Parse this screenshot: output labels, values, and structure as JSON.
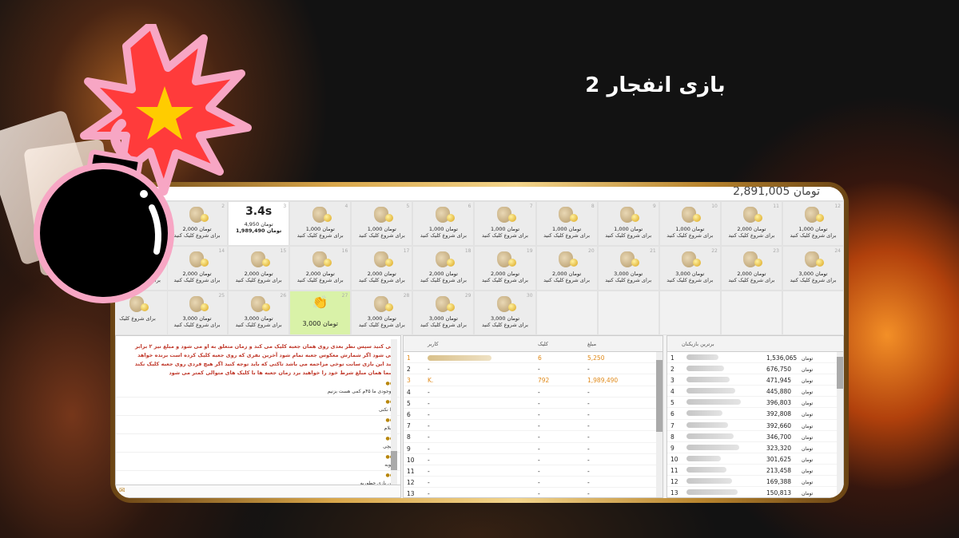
{
  "page": {
    "title": "بازی انفجار 2"
  },
  "header": {
    "balance": "2,891,005",
    "balance_unit": "تومان"
  },
  "tiles": [
    {
      "num": "12",
      "amount": "1,000",
      "unit": "تومان",
      "caption": "برای شروع کلیک کنید",
      "state": "normal"
    },
    {
      "num": "11",
      "amount": "2,000",
      "unit": "تومان",
      "caption": "برای شروع کلیک کنید",
      "state": "normal"
    },
    {
      "num": "10",
      "amount": "1,000",
      "unit": "تومان",
      "caption": "برای شروع کلیک کنید",
      "state": "normal"
    },
    {
      "num": "9",
      "amount": "1,000",
      "unit": "تومان",
      "caption": "برای شروع کلیک کنید",
      "state": "normal"
    },
    {
      "num": "8",
      "amount": "1,000",
      "unit": "تومان",
      "caption": "برای شروع کلیک کنید",
      "state": "normal"
    },
    {
      "num": "7",
      "amount": "1,000",
      "unit": "تومان",
      "caption": "برای شروع کلیک کنید",
      "state": "normal"
    },
    {
      "num": "6",
      "amount": "1,000",
      "unit": "تومان",
      "caption": "برای شروع کلیک کنید",
      "state": "normal"
    },
    {
      "num": "5",
      "amount": "1,000",
      "unit": "تومان",
      "caption": "برای شروع کلیک کنید",
      "state": "normal"
    },
    {
      "num": "4",
      "amount": "1,000",
      "unit": "تومان",
      "caption": "برای شروع کلیک کنید",
      "state": "normal"
    },
    {
      "num": "3",
      "timer": "3.4s",
      "amount": "4,950",
      "unit": "تومان",
      "total": "1,989,490",
      "state": "active"
    },
    {
      "num": "2",
      "amount": "2,000",
      "unit": "تومان",
      "caption": "برای شروع کلیک کنید",
      "state": "normal"
    },
    {
      "num": "24",
      "amount": "3,000",
      "unit": "تومان",
      "caption": "برای شروع کلیک کنید",
      "state": "normal"
    },
    {
      "num": "23",
      "amount": "2,000",
      "unit": "تومان",
      "caption": "برای شروع کلیک کنید",
      "state": "normal"
    },
    {
      "num": "22",
      "amount": "3,000",
      "unit": "تومان",
      "caption": "برای شروع کلیک کنید",
      "state": "normal"
    },
    {
      "num": "21",
      "amount": "3,000",
      "unit": "تومان",
      "caption": "برای شروع کلیک کنید",
      "state": "normal"
    },
    {
      "num": "20",
      "amount": "2,000",
      "unit": "تومان",
      "caption": "برای شروع کلیک کنید",
      "state": "normal"
    },
    {
      "num": "19",
      "amount": "2,000",
      "unit": "تومان",
      "caption": "برای شروع کلیک کنید",
      "state": "normal"
    },
    {
      "num": "18",
      "amount": "2,000",
      "unit": "تومان",
      "caption": "برای شروع کلیک کنید",
      "state": "normal"
    },
    {
      "num": "17",
      "amount": "2,000",
      "unit": "تومان",
      "caption": "برای شروع کلیک کنید",
      "state": "normal"
    },
    {
      "num": "16",
      "amount": "2,000",
      "unit": "تومان",
      "caption": "برای شروع کلیک کنید",
      "state": "normal"
    },
    {
      "num": "15",
      "amount": "2,000",
      "unit": "تومان",
      "caption": "برای شروع کلیک کنید",
      "state": "normal"
    },
    {
      "num": "14",
      "amount": "2,000",
      "unit": "تومان",
      "caption": "برای شروع کلیک کنید",
      "state": "normal"
    },
    {
      "num": "",
      "amount": "",
      "unit": "",
      "caption": "",
      "state": "empty"
    },
    {
      "num": "",
      "amount": "",
      "unit": "",
      "caption": "",
      "state": "empty"
    },
    {
      "num": "",
      "amount": "",
      "unit": "",
      "caption": "",
      "state": "empty"
    },
    {
      "num": "",
      "amount": "",
      "unit": "",
      "caption": "",
      "state": "empty"
    },
    {
      "num": "",
      "amount": "",
      "unit": "",
      "caption": "",
      "state": "empty"
    },
    {
      "num": "30",
      "amount": "3,000",
      "unit": "تومان",
      "caption": "برای شروع کلیک کنید",
      "state": "normal"
    },
    {
      "num": "29",
      "amount": "3,000",
      "unit": "تومان",
      "caption": "برای شروع کلیک کنید",
      "state": "normal"
    },
    {
      "num": "28",
      "amount": "3,000",
      "unit": "تومان",
      "caption": "برای شروع کلیک کنید",
      "state": "normal"
    },
    {
      "num": "27",
      "amount": "3,000",
      "unit": "تومان",
      "state": "won"
    },
    {
      "num": "26",
      "amount": "3,000",
      "unit": "تومان",
      "caption": "برای شروع کلیک کنید",
      "state": "normal"
    },
    {
      "num": "25",
      "amount": "3,000",
      "unit": "تومان",
      "caption": "برای شروع کلیک کنید",
      "state": "normal"
    }
  ],
  "left_tiles": [
    {
      "amount": "2,000",
      "unit": "تومان",
      "caption": "برای شروع کلیک کنید"
    },
    {
      "amount": "2,000",
      "unit": "تومان",
      "caption": "برای شروع کلیک کنید"
    },
    {
      "amount": "",
      "unit": "",
      "caption": "برای شروع کلیک"
    }
  ],
  "chat": {
    "notice": "می کنید سپس نظر بعدی روی همان جعبه کلیک می کند و زمان متعلق به او می شود و مبلغ نیز ۲ برابر می شود اگر شمارش معکوس جعبه تمام شود آخرین نفری که روی جعبه کلیک کرده است برنده خواهد شد این بازی سانت توخی مزاحمه می باشد تاکتی که باید توجه کنید اگر هیچ فردی روی جعبه کلیک نکند شما همان مبلغ شرط خود را خواهید برد زمان جعبه ها با کلیک های متوالی کمتر می شود",
    "messages": [
      {
        "user": "●●",
        "text": "موجودی ما ۴۵م کمی هست بزنیم"
      },
      {
        "user": "●●",
        "text": "بیا نکنی"
      },
      {
        "user": "●●",
        "text": "سلام"
      },
      {
        "user": "●●",
        "text": "هیچی"
      },
      {
        "user": "●●",
        "text": "خوبه"
      },
      {
        "user": "●●",
        "text": "این بازی چطوریه"
      }
    ]
  },
  "bets": {
    "headers": {
      "user": "کاربر",
      "click": "کلیک",
      "amount": "مبلغ"
    },
    "rows": [
      {
        "n": "1",
        "user": "",
        "click": "6",
        "amount": "5,250",
        "hl": true
      },
      {
        "n": "2",
        "user": "-",
        "click": "-",
        "amount": "-",
        "hl": false
      },
      {
        "n": "3",
        "user": "K.",
        "click": "792",
        "amount": "1,989,490",
        "hl": true
      },
      {
        "n": "4",
        "user": "-",
        "click": "-",
        "amount": "-",
        "hl": false
      },
      {
        "n": "5",
        "user": "-",
        "click": "-",
        "amount": "-",
        "hl": false
      },
      {
        "n": "6",
        "user": "-",
        "click": "-",
        "amount": "-",
        "hl": false
      },
      {
        "n": "7",
        "user": "-",
        "click": "-",
        "amount": "-",
        "hl": false
      },
      {
        "n": "8",
        "user": "-",
        "click": "-",
        "amount": "-",
        "hl": false
      },
      {
        "n": "9",
        "user": "-",
        "click": "-",
        "amount": "-",
        "hl": false
      },
      {
        "n": "10",
        "user": "-",
        "click": "-",
        "amount": "-",
        "hl": false
      },
      {
        "n": "11",
        "user": "-",
        "click": "-",
        "amount": "-",
        "hl": false
      },
      {
        "n": "12",
        "user": "-",
        "click": "-",
        "amount": "-",
        "hl": false
      },
      {
        "n": "13",
        "user": "-",
        "click": "-",
        "amount": "-",
        "hl": false
      }
    ]
  },
  "top_players": {
    "header": "برترین بازیکنان",
    "unit": "تومان",
    "rows": [
      {
        "n": "1",
        "amount": "1,536,065"
      },
      {
        "n": "2",
        "amount": "676,750"
      },
      {
        "n": "3",
        "amount": "471,945"
      },
      {
        "n": "4",
        "amount": "445,880"
      },
      {
        "n": "5",
        "amount": "396,803"
      },
      {
        "n": "6",
        "amount": "392,808"
      },
      {
        "n": "7",
        "amount": "392,660"
      },
      {
        "n": "8",
        "amount": "346,700"
      },
      {
        "n": "9",
        "amount": "323,320"
      },
      {
        "n": "10",
        "amount": "301,625"
      },
      {
        "n": "11",
        "amount": "213,458"
      },
      {
        "n": "12",
        "amount": "169,388"
      },
      {
        "n": "13",
        "amount": "150,813"
      }
    ]
  },
  "colors": {
    "gold": "#d8a64a",
    "highlight": "#e08a1a",
    "won_tile": "#d9f2a8",
    "bomb_pink": "#f7a6c4",
    "explosion_red": "#ff3b3b",
    "star_yellow": "#ffcc00"
  }
}
